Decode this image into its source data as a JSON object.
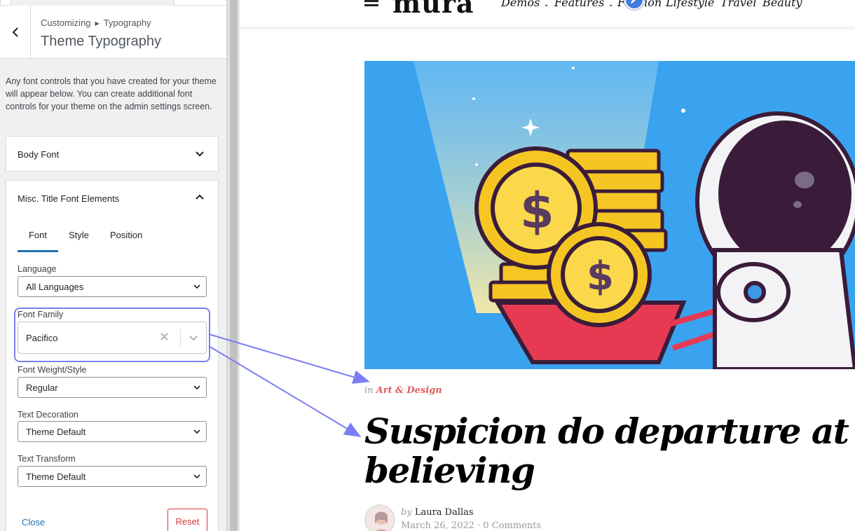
{
  "customizer": {
    "breadcrumb_root": "Customizing",
    "breadcrumb_current": "Typography",
    "panel_title": "Theme Typography",
    "description": "Any font controls that you have created for your theme will appear below. You can create additional font controls for your theme on the admin settings screen.",
    "sections": {
      "body_font": "Body Font",
      "misc_title": "Misc. Title Font Elements"
    },
    "tabs": [
      "Font",
      "Style",
      "Position"
    ],
    "fields": {
      "language_label": "Language",
      "language_value": "All Languages",
      "font_family_label": "Font Family",
      "font_family_value": "Pacifico",
      "font_weight_label": "Font Weight/Style",
      "font_weight_value": "Regular",
      "text_decoration_label": "Text Decoration",
      "text_decoration_value": "Theme Default",
      "text_transform_label": "Text Transform",
      "text_transform_value": "Theme Default"
    },
    "close_label": "Close",
    "reset_label": "Reset"
  },
  "preview": {
    "logo": "mura",
    "nav": [
      "Demos",
      "Features",
      "Fashion",
      "Lifestyle",
      "Travel",
      "Beauty"
    ],
    "category_prefix": "in",
    "category": "Art & Design",
    "title_line1": "Suspicion do departure at extremely he",
    "title_line2": "believing",
    "byline_prefix": "by",
    "author": "Laura Dallas",
    "date": "March 26, 2022",
    "comments": "0 Comments"
  },
  "colors": {
    "accent": "#2271b1",
    "highlight": "#7b7ef2",
    "reset": "#d63638",
    "category": "#e55a5a"
  }
}
